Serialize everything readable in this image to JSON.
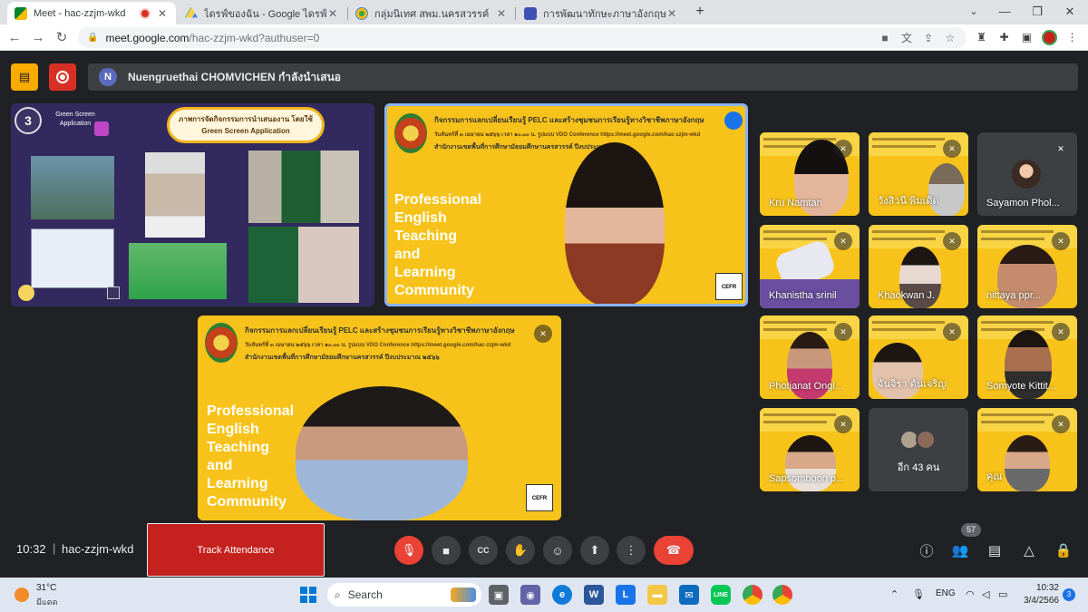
{
  "browser": {
    "tabs": [
      {
        "title": "Meet - hac-zzjm-wkd",
        "active": true,
        "recording": true
      },
      {
        "title": "ไดรฟ์ของฉัน - Google ไดรฟ์",
        "active": false
      },
      {
        "title": "กลุ่มนิเทศ สพม.นครสวรรค์",
        "active": false
      },
      {
        "title": "การพัฒนาทักษะภาษาอังกฤษ English",
        "active": false
      }
    ],
    "new_tab": "+",
    "window_controls": {
      "minimize": "—",
      "maximize": "❐",
      "close": "✕"
    },
    "address": {
      "host": "meet.google.com",
      "path": "/hac-zzjm-wkd?authuser=0"
    }
  },
  "meet": {
    "presenter": {
      "initial": "N",
      "text": "Nuengruethai CHOMVICHEN กำลังนำเสนอ"
    },
    "presentation": {
      "step": "3",
      "app_label": "Green Screen Application",
      "banner": "ภาพการจัดกิจกรรมการนำเสนองาน โดยใช้ Green Screen Application"
    },
    "main_slide": {
      "heading": "กิจกรรมการแลกเปลี่ยนเรียนรู้ PELC และสร้างชุมชนการเรียนรู้ทางวิชาชีพภาษาอังกฤษ",
      "subheading": "วันจันทร์ที่ ๓ เมษายน ๒๕๖๖ เวลา ๑๐.๐๐ น. รูปแบบ VDO Conference https://meet.google.com/hac-zzjm-wkd",
      "office": "สำนักงานเขตพื้นที่การศึกษามัธยมศึกษานครสวรรค์  ปีงบประมาณ ๒๕๖๖",
      "title_lines": [
        "Professional",
        "English",
        "Teaching",
        "and",
        "Learning",
        "Community"
      ],
      "badge": "CEFR"
    },
    "participants": [
      {
        "name": "Kru Namtan",
        "muted": true
      },
      {
        "name": "วังสิวนี พิมเดิด",
        "muted": true
      },
      {
        "name": "Sayamon Phol...",
        "muted": true
      },
      {
        "name": "Khanistha srinil",
        "muted": true
      },
      {
        "name": "Khaokwan J.",
        "muted": true
      },
      {
        "name": "nittaya ppr...",
        "muted": true
      },
      {
        "name": "Photjanat Ongl...",
        "muted": true
      },
      {
        "name": "จันจิรา ตันเจริญ",
        "muted": true
      },
      {
        "name": "Somyote Kittit...",
        "muted": true
      },
      {
        "name": "Sapsomboon p...",
        "muted": true
      },
      {
        "name": "อีก 43 คน",
        "muted": false
      },
      {
        "name": "คุณ",
        "muted": true
      }
    ],
    "bottom": {
      "time": "10:32",
      "separator": "|",
      "code": "hac-zzjm-wkd",
      "track_button": "Track Attendance",
      "people_count": "57"
    }
  },
  "taskbar": {
    "weather_temp": "31°C",
    "weather_desc": "มีแดด",
    "search_label": "Search",
    "lang": "ENG",
    "time": "10:32",
    "date": "3/4/2566",
    "notifications": "3"
  },
  "colors": {
    "slide_yellow": "#f7c31a",
    "meet_bg": "#202124",
    "end_call": "#ea4335",
    "track_red": "#c5221f"
  }
}
